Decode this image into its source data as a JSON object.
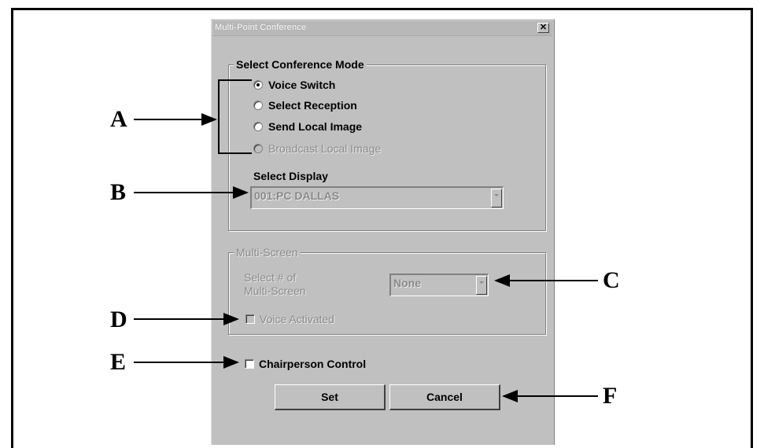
{
  "dialog": {
    "title": "Multi-Point Conference",
    "close_label": "✕"
  },
  "conference_mode": {
    "legend": "Select Conference Mode",
    "options": [
      {
        "label": "Voice Switch",
        "checked": true,
        "enabled": true
      },
      {
        "label": "Select Reception",
        "checked": false,
        "enabled": true
      },
      {
        "label": "Send Local Image",
        "checked": false,
        "enabled": true
      },
      {
        "label": "Broadcast Local Image",
        "checked": false,
        "enabled": false
      }
    ],
    "display_label": "Select Display",
    "display_value": "001:PC DALLAS"
  },
  "multi_screen": {
    "legend": "Multi-Screen",
    "select_label_line1": "Select # of",
    "select_label_line2": "Multi-Screen",
    "select_value": "None",
    "voice_activated_label": "Voice Activated"
  },
  "chairperson_label": "Chairperson Control",
  "buttons": {
    "set": "Set",
    "cancel": "Cancel"
  },
  "callouts": [
    "A",
    "B",
    "C",
    "D",
    "E",
    "F"
  ],
  "colors": {
    "dialog_bg": "#c0c0c0",
    "disabled_text": "#8a8a8a"
  }
}
